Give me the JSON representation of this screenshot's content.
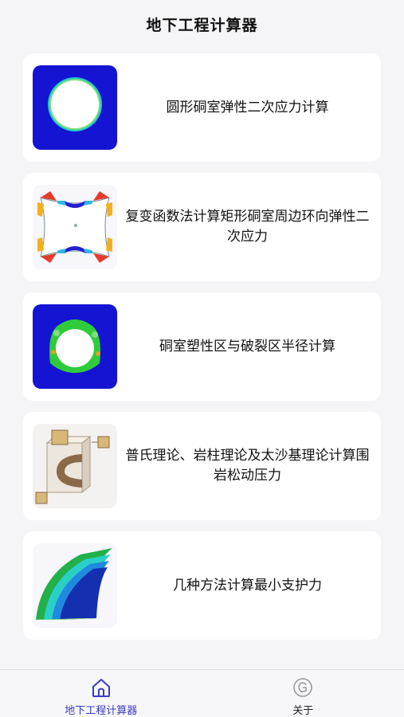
{
  "header": {
    "title": "地下工程计算器"
  },
  "cards": [
    {
      "label": "圆形硐室弹性二次应力计算",
      "icon": "circular-chamber-stress-icon"
    },
    {
      "label": "复变函数法计算矩形硐室周边环向弹性二次应力",
      "icon": "rectangular-chamber-stress-icon"
    },
    {
      "label": "硐室塑性区与破裂区半径计算",
      "icon": "plastic-zone-icon"
    },
    {
      "label": "普氏理论、岩柱理论及太沙基理论计算围岩松动压力",
      "icon": "rock-block-icon"
    },
    {
      "label": "几种方法计算最小支护力",
      "icon": "support-arch-icon"
    }
  ],
  "tabbar": {
    "items": [
      {
        "label": "地下工程计算器",
        "icon": "home-icon",
        "active": true
      },
      {
        "label": "关于",
        "icon": "about-icon",
        "active": false
      }
    ]
  },
  "colors": {
    "accent": "#3b3bc4",
    "fem_blue": "#1414d2"
  }
}
